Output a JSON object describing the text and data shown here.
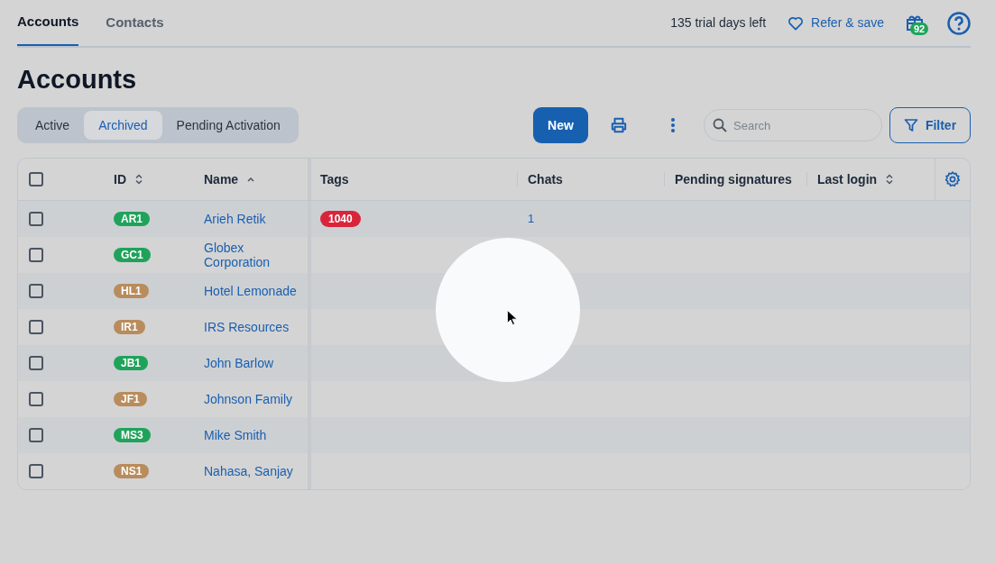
{
  "nav_tabs": [
    {
      "label": "Accounts",
      "selected": true
    },
    {
      "label": "Contacts",
      "selected": false
    }
  ],
  "header": {
    "trial": "135 trial days left",
    "refer": "Refer & save",
    "gift_count": "92"
  },
  "title": "Accounts",
  "status_tabs": [
    {
      "label": "Active",
      "selected": false
    },
    {
      "label": "Archived",
      "selected": true
    },
    {
      "label": "Pending Activation",
      "selected": false
    }
  ],
  "toolbar": {
    "new_button": "New",
    "search": {
      "placeholder": "Search"
    },
    "filter_button": "Filter"
  },
  "table": {
    "select_all_checked": false,
    "columns": [
      {
        "label": "ID",
        "kind": "sortable"
      },
      {
        "label": "Name",
        "kind": "ascending"
      },
      {
        "label": "Tags",
        "kind": "plain"
      },
      {
        "label": "Chats",
        "kind": "plain"
      },
      {
        "label": "Pending signatures",
        "kind": "plain"
      },
      {
        "label": "Last login",
        "kind": "sortable"
      }
    ],
    "rows": [
      {
        "checked": false,
        "id": "AR1",
        "color": "#1fa35a",
        "name": "Arieh Retik",
        "tags": [
          {
            "label": "1040",
            "color": "#d9253a"
          }
        ],
        "chats": "1"
      },
      {
        "checked": false,
        "id": "GC1",
        "color": "#1fa35a",
        "name": "Globex Corporation",
        "tags": [],
        "chats": ""
      },
      {
        "checked": false,
        "id": "HL1",
        "color": "#b88c5c",
        "name": "Hotel Lemonade",
        "tags": [],
        "chats": ""
      },
      {
        "checked": false,
        "id": "IR1",
        "color": "#b88c5c",
        "name": "IRS Resources",
        "tags": [],
        "chats": ""
      },
      {
        "checked": false,
        "id": "JB1",
        "color": "#1fa35a",
        "name": "John Barlow",
        "tags": [],
        "chats": ""
      },
      {
        "checked": false,
        "id": "JF1",
        "color": "#b88c5c",
        "name": "Johnson Family",
        "tags": [],
        "chats": ""
      },
      {
        "checked": false,
        "id": "MS3",
        "color": "#1fa35a",
        "name": "Mike Smith",
        "tags": [],
        "chats": ""
      },
      {
        "checked": false,
        "id": "NS1",
        "color": "#b88c5c",
        "name": "Nahasa, Sanjay",
        "tags": [],
        "chats": ""
      }
    ]
  }
}
